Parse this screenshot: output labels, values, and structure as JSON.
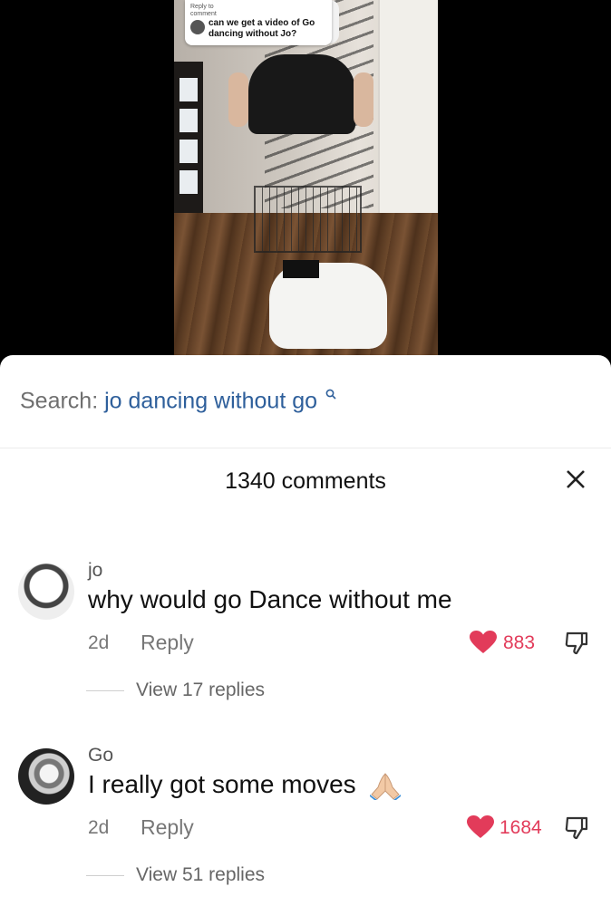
{
  "video": {
    "caption": {
      "top_line": "Reply to",
      "label": "comment",
      "question": "can we get a video of Go dancing without Jo?"
    }
  },
  "search": {
    "prefix": "Search:",
    "term": "jo dancing without go",
    "icon": "search-icon"
  },
  "comments_header": {
    "count": "1340 comments",
    "close_icon": "close-icon"
  },
  "comments": [
    {
      "username": "jo",
      "text": "why would go Dance without me",
      "time": "2d",
      "reply_label": "Reply",
      "likes": "883",
      "view_replies": "View 17 replies"
    },
    {
      "username": "Go",
      "text": "I really got some moves",
      "emoji": "folded-hands",
      "time": "2d",
      "reply_label": "Reply",
      "likes": "1684",
      "view_replies": "View 51 replies"
    }
  ],
  "colors": {
    "accent_blue": "#2e5f9b",
    "like_red": "#e23b5a"
  }
}
